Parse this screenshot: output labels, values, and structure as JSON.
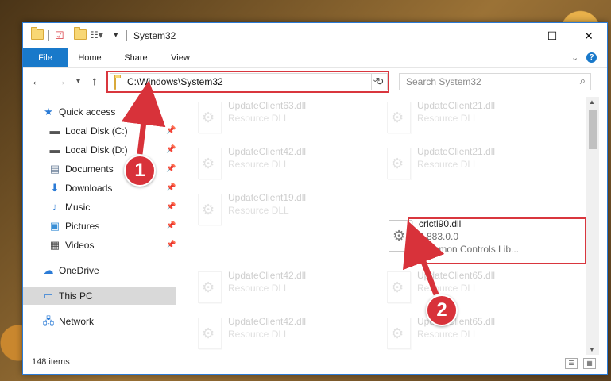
{
  "window": {
    "title": "System32",
    "controls": {
      "minimize": "—",
      "maximize": "☐",
      "close": "✕"
    }
  },
  "ribbon": {
    "tabs": [
      "File",
      "Home",
      "Share",
      "View"
    ],
    "help": "?"
  },
  "navigation": {
    "back": "←",
    "forward": "→",
    "recent": "▾",
    "up": "↑",
    "address_path": "C:\\Windows\\System32",
    "refresh": "↻",
    "search_placeholder": "Search System32"
  },
  "sidebar": {
    "items": [
      {
        "label": "Quick access",
        "icon": "star-icon"
      },
      {
        "label": "Local Disk (C:)",
        "icon": "drive-icon",
        "pinned": true
      },
      {
        "label": "Local Disk (D:)",
        "icon": "drive-icon",
        "pinned": true
      },
      {
        "label": "Documents",
        "icon": "documents-icon",
        "pinned": true
      },
      {
        "label": "Downloads",
        "icon": "download-icon",
        "pinned": true
      },
      {
        "label": "Music",
        "icon": "music-icon",
        "pinned": true
      },
      {
        "label": "Pictures",
        "icon": "pictures-icon",
        "pinned": true
      },
      {
        "label": "Videos",
        "icon": "videos-icon",
        "pinned": true
      },
      {
        "label": "OneDrive",
        "icon": "cloud-icon"
      },
      {
        "label": "This PC",
        "icon": "computer-icon",
        "selected": true
      },
      {
        "label": "Network",
        "icon": "network-icon"
      }
    ]
  },
  "files": {
    "faded": [
      {
        "name": "UpdateClient63.dll",
        "type": "Resource DLL"
      },
      {
        "name": "UpdateClient21.dll",
        "type": "Resource DLL"
      },
      {
        "name": "UpdateClient42.dll",
        "type": "Resource DLL"
      },
      {
        "name": "UpdateClient21.dll",
        "type": "Resource DLL"
      },
      {
        "name": "UpdateClient19.dll",
        "type": "Resource DLL"
      },
      {
        "name": "UpdateClient42.dll",
        "type": "Resource DLL"
      },
      {
        "name": "UpdateClient65.dll",
        "type": "Resource DLL"
      },
      {
        "name": "UpdateClient42.dll",
        "type": "Resource DLL"
      },
      {
        "name": "UpdateClient65.dll",
        "type": "Resource DLL"
      }
    ],
    "highlighted": {
      "name": "crlctl90.dll",
      "version": "9.883.0.0",
      "description": "Common Controls Lib..."
    }
  },
  "status": {
    "item_count": "148 items"
  },
  "annotations": {
    "step1": "1",
    "step2": "2",
    "highlight_color": "#d9363e"
  }
}
